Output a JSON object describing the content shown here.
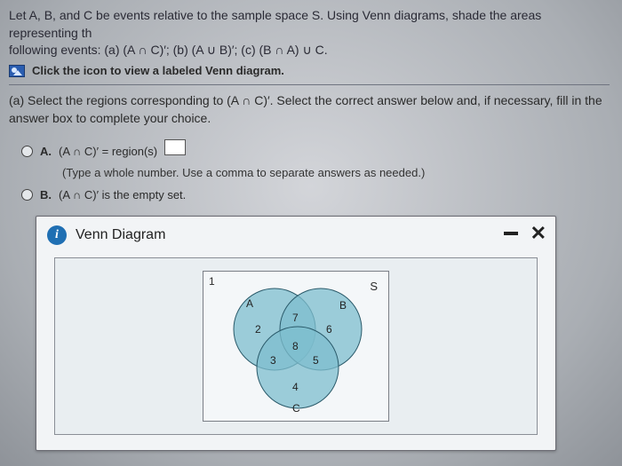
{
  "problem": {
    "line1": "Let A, B, and C be events relative to the sample space S. Using Venn diagrams, shade the areas representing th",
    "line2": "following events: (a) (A ∩ C)′; (b) (A ∪ B)′; (c) (B ∩ A) ∪ C.",
    "view_label": "Click the icon to view a labeled Venn diagram."
  },
  "part": {
    "prompt_line1": "(a) Select the regions corresponding to (A ∩ C)′. Select the correct answer below and, if necessary, fill in the",
    "prompt_line2": "answer box to complete your choice."
  },
  "choices": {
    "a": {
      "letter": "A.",
      "text": "(A ∩ C)′ = region(s)",
      "hint": "(Type a whole number. Use a comma to separate answers as needed.)"
    },
    "b": {
      "letter": "B.",
      "text": "(A ∩ C)′ is the empty set."
    }
  },
  "popup": {
    "title": "Venn Diagram",
    "info_glyph": "i"
  },
  "venn": {
    "region1": "1",
    "labelS": "S",
    "labelA": "A",
    "labelB": "B",
    "labelC": "C",
    "region2": "2",
    "region3": "3",
    "region4": "4",
    "region5": "5",
    "region6": "6",
    "region7": "7",
    "region8": "8"
  }
}
